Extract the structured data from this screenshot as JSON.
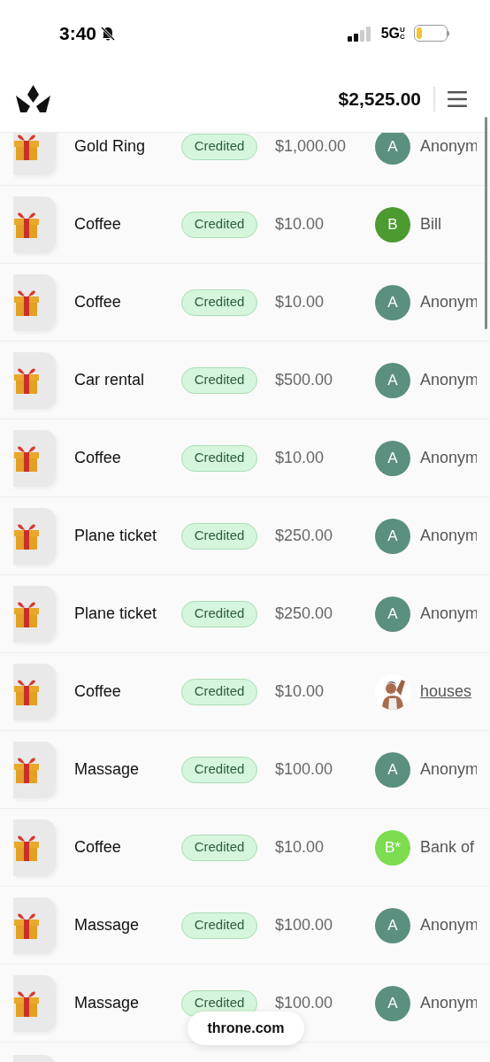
{
  "status_bar": {
    "time": "3:40",
    "network": "5G",
    "network_suffix": "UC"
  },
  "header": {
    "balance": "$2,525.00"
  },
  "rows": [
    {
      "item": "Gold Ring",
      "status": "Credited",
      "amount": "$1,000.00",
      "sender": {
        "kind": "letter",
        "initial": "A",
        "color": "#5b8f80",
        "name": "Anonym"
      }
    },
    {
      "item": "Coffee",
      "status": "Credited",
      "amount": "$10.00",
      "sender": {
        "kind": "letter",
        "initial": "B",
        "color": "#4c9a30",
        "name": "Bill"
      }
    },
    {
      "item": "Coffee",
      "status": "Credited",
      "amount": "$10.00",
      "sender": {
        "kind": "letter",
        "initial": "A",
        "color": "#5b8f80",
        "name": "Anonym"
      }
    },
    {
      "item": "Car rental",
      "status": "Credited",
      "amount": "$500.00",
      "sender": {
        "kind": "letter",
        "initial": "A",
        "color": "#5b8f80",
        "name": "Anonym"
      }
    },
    {
      "item": "Coffee",
      "status": "Credited",
      "amount": "$10.00",
      "sender": {
        "kind": "letter",
        "initial": "A",
        "color": "#5b8f80",
        "name": "Anonym"
      }
    },
    {
      "item": "Plane ticket",
      "status": "Credited",
      "amount": "$250.00",
      "sender": {
        "kind": "letter",
        "initial": "A",
        "color": "#5b8f80",
        "name": "Anonym"
      }
    },
    {
      "item": "Plane ticket",
      "status": "Credited",
      "amount": "$250.00",
      "sender": {
        "kind": "letter",
        "initial": "A",
        "color": "#5b8f80",
        "name": "Anonym"
      }
    },
    {
      "item": "Coffee",
      "status": "Credited",
      "amount": "$10.00",
      "sender": {
        "kind": "picture",
        "name": "houses"
      }
    },
    {
      "item": "Massage",
      "status": "Credited",
      "amount": "$100.00",
      "sender": {
        "kind": "letter",
        "initial": "A",
        "color": "#5b8f80",
        "name": "Anonym"
      }
    },
    {
      "item": "Coffee",
      "status": "Credited",
      "amount": "$10.00",
      "sender": {
        "kind": "letter",
        "initial": "B*",
        "color": "#7ddc4f",
        "name": "Bank of"
      }
    },
    {
      "item": "Massage",
      "status": "Credited",
      "amount": "$100.00",
      "sender": {
        "kind": "letter",
        "initial": "A",
        "color": "#5b8f80",
        "name": "Anonym"
      }
    },
    {
      "item": "Massage",
      "status": "Credited",
      "amount": "$100.00",
      "sender": {
        "kind": "letter",
        "initial": "A",
        "color": "#5b8f80",
        "name": "Anonym"
      }
    }
  ],
  "browser_bar": {
    "url": "throne.com"
  }
}
